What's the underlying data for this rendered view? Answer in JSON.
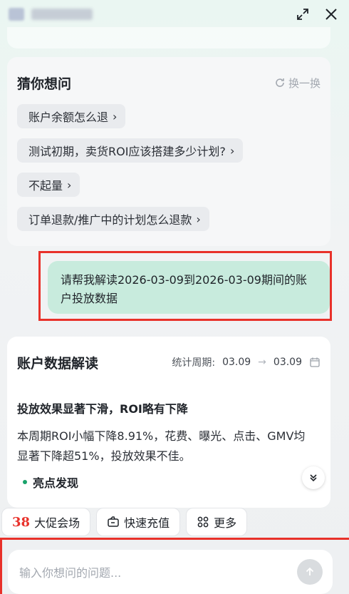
{
  "header": {
    "expand_icon": "expand-icon",
    "close_icon": "close-icon"
  },
  "suggestions": {
    "title": "猜你想问",
    "refresh_label": "换一换",
    "items": [
      "账户余额怎么退",
      "测试初期，卖货ROI应该搭建多少计划?",
      "不起量",
      "订单退款/推广中的计划怎么退款"
    ]
  },
  "user_message": {
    "text": "请帮我解读2026-03-09到2026-03-09期间的账户投放数据"
  },
  "data_card": {
    "title": "账户数据解读",
    "period_label": "统计周期:",
    "start": "03.09",
    "arrow": "→",
    "end": "03.09",
    "headline": "投放效果显著下滑，ROI略有下降",
    "summary": "本周期ROI小幅下降8.91%，花费、曝光、点击、GMV均显著下降超51%，投放效果不佳。",
    "highlight": "亮点发现"
  },
  "quick_actions": {
    "promo_number": "38",
    "promo_label": "大促会场",
    "recharge_label": "快速充值",
    "more_label": "更多"
  },
  "input": {
    "placeholder": "输入你想问的问题..."
  },
  "colors": {
    "accent_red": "#e8312a",
    "user_bubble": "#c8ebdd",
    "green_dot": "#18a36b"
  }
}
